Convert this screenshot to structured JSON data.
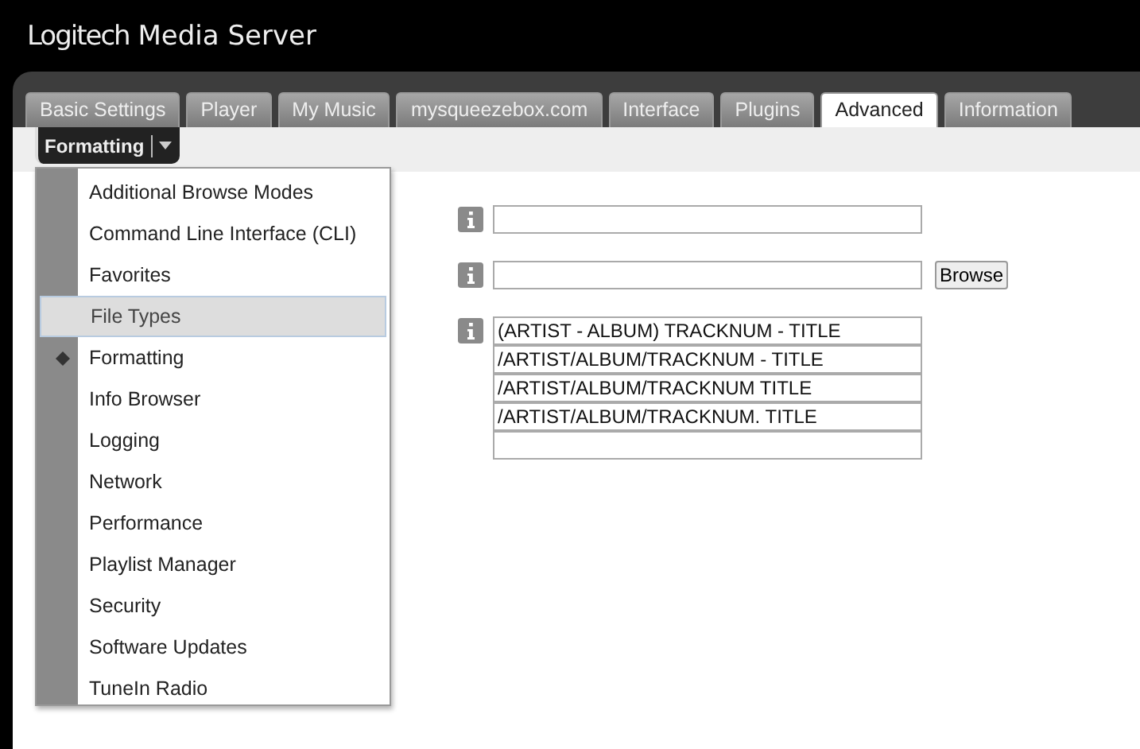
{
  "header": {
    "brand": "Logitech",
    "title": "Media Server"
  },
  "tabs": [
    {
      "label": "Basic Settings",
      "selected": false
    },
    {
      "label": "Player",
      "selected": false
    },
    {
      "label": "My Music",
      "selected": false
    },
    {
      "label": "mysqueezebox.com",
      "selected": false
    },
    {
      "label": "Interface",
      "selected": false
    },
    {
      "label": "Plugins",
      "selected": false
    },
    {
      "label": "Advanced",
      "selected": true
    },
    {
      "label": "Information",
      "selected": false
    }
  ],
  "section_dropdown": {
    "label": "Formatting"
  },
  "dropdown_menu": {
    "items": [
      {
        "label": "Additional Browse Modes",
        "checked": false,
        "highlighted": false
      },
      {
        "label": "Command Line Interface (CLI)",
        "checked": false,
        "highlighted": false
      },
      {
        "label": "Favorites",
        "checked": false,
        "highlighted": false
      },
      {
        "label": "File Types",
        "checked": false,
        "highlighted": true
      },
      {
        "label": "Formatting",
        "checked": true,
        "highlighted": false
      },
      {
        "label": "Info Browser",
        "checked": false,
        "highlighted": false
      },
      {
        "label": "Logging",
        "checked": false,
        "highlighted": false
      },
      {
        "label": "Network",
        "checked": false,
        "highlighted": false
      },
      {
        "label": "Performance",
        "checked": false,
        "highlighted": false
      },
      {
        "label": "Playlist Manager",
        "checked": false,
        "highlighted": false
      },
      {
        "label": "Security",
        "checked": false,
        "highlighted": false
      },
      {
        "label": "Software Updates",
        "checked": false,
        "highlighted": false
      },
      {
        "label": "TuneIn Radio",
        "checked": false,
        "highlighted": false
      }
    ]
  },
  "settings": [
    {
      "kind": "text"
    },
    {
      "kind": "browse",
      "button": "Browse"
    },
    {
      "kind": "list",
      "values": [
        "(ARTIST - ALBUM) TRACKNUM - TITLE",
        "/ARTIST/ALBUM/TRACKNUM - TITLE",
        "/ARTIST/ALBUM/TRACKNUM TITLE",
        "/ARTIST/ALBUM/TRACKNUM. TITLE"
      ],
      "blank_row": true
    }
  ]
}
